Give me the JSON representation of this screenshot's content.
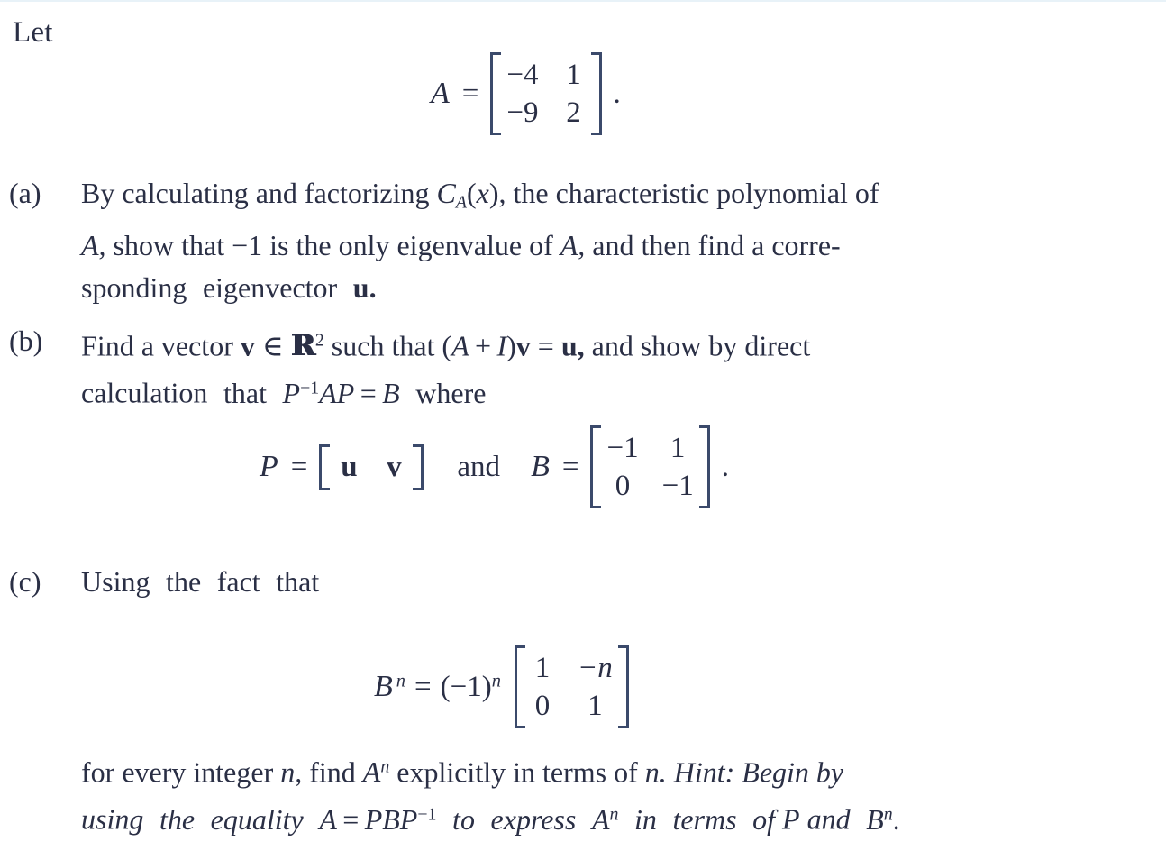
{
  "document": {
    "type": "math-exercise",
    "lead_text": "Let",
    "text_color": "#2a2f45",
    "bracket_color": "#3b4a6b"
  },
  "matrix_A": {
    "label": "A",
    "equals": "=",
    "rows": [
      [
        "−4",
        "1"
      ],
      [
        "−9",
        "2"
      ]
    ],
    "trailing_punctuation": "."
  },
  "parts": [
    {
      "marker": "(a)",
      "lines": [
        {
          "segments": [
            "By",
            "calculating",
            "and",
            "factorizing",
            "C",
            "A",
            "(",
            "x",
            "),",
            "the",
            "characteristic",
            "polynomial",
            "of"
          ],
          "plain": "By calculating and factorizing C_A(x), the characteristic polynomial of"
        },
        {
          "plain": "A, show that −1 is the only eigenvalue of A, and then find a corre-"
        },
        {
          "plain": "sponding eigenvector u."
        }
      ],
      "tokens": {
        "w_by": "By",
        "w_calculating": "calculating",
        "w_and": "and",
        "w_factorizing": "factorizing",
        "c_sym": "C",
        "c_sub": "A",
        "paren_open": "(",
        "var_x": "x",
        "paren_close_comma": "),",
        "w_the": "the",
        "w_characteristic": "characteristic",
        "w_polynomial": "polynomial",
        "w_of": "of",
        "var_A1": "A,",
        "w_show": "show",
        "w_that": "that",
        "val_neg1": "−1",
        "w_is": "is",
        "w_the2": "the",
        "w_only": "only",
        "w_eigenvalue": "eigenvalue",
        "w_of2": "of",
        "var_A2": "A,",
        "w_and2": "and",
        "w_then": "then",
        "w_find": "find",
        "w_a": "a",
        "w_corre": "corre-",
        "w_sponding": "sponding",
        "w_eigenvector": "eigenvector",
        "vec_u": "u."
      }
    },
    {
      "marker": "(b)",
      "tokens": {
        "w_find": "Find",
        "w_a": "a",
        "w_vector": "vector",
        "vec_v": "v",
        "sym_in": "∈",
        "set_R": "R",
        "set_R_sup": "2",
        "w_such": "such",
        "w_that": "that",
        "grp_open": "(",
        "var_A": "A",
        "plus": "+",
        "var_I": "I",
        "grp_close": ")",
        "vec_v2": "v",
        "equals": "=",
        "vec_u": "u,",
        "w_and": "and",
        "w_show": "show",
        "w_by": "by",
        "w_direct": "direct",
        "w_calculation": "calculation",
        "w_that2": "that",
        "var_P": "P",
        "sup_inv": "−1",
        "var_AP": "AP",
        "equals2": "=",
        "var_B": "B",
        "w_where": "where"
      },
      "lines": [
        {
          "plain": "Find a vector v ∈ R^2 such that (A + I)v = u, and show by direct"
        },
        {
          "plain": "calculation that P^{-1}AP = B where"
        }
      ]
    },
    {
      "marker": "(c)",
      "tokens": {
        "w_using": "Using",
        "w_the": "the",
        "w_fact": "fact",
        "w_that": "that"
      },
      "lines": [
        {
          "plain": "Using the fact that"
        }
      ]
    }
  ],
  "equation_PB": {
    "P_label": "P",
    "P_equals": "=",
    "P_entries": [
      "u",
      "v"
    ],
    "conjunction": "and",
    "B_label": "B",
    "B_equals": "=",
    "B_rows": [
      [
        "−1",
        "1"
      ],
      [
        "0",
        "−1"
      ]
    ],
    "trailing_punctuation": "."
  },
  "equation_Bn": {
    "lhs_base": "B",
    "lhs_exponent": "n",
    "equals": "=",
    "scalar": "(−1)",
    "scalar_exponent": "n",
    "rows": [
      [
        "1",
        "−n"
      ],
      [
        "0",
        "1"
      ]
    ]
  },
  "closing": {
    "line1_tokens": {
      "w_for": "for",
      "w_every": "every",
      "w_integer": "integer",
      "var_n": "n,",
      "w_find": "find",
      "var_A": "A",
      "var_A_sup": "n",
      "w_explicitly": "explicitly",
      "w_in": "in",
      "w_terms": "terms",
      "w_of": "of",
      "var_n2": "n.",
      "hint_label": "Hint:",
      "hint_w1": "Begin",
      "hint_w2": "by"
    },
    "line2_tokens": {
      "w_using": "using",
      "w_the": "the",
      "w_equality": "equality",
      "var_A": "A",
      "equals": "=",
      "var_PBP": "PBP",
      "sup_inv": "−1",
      "w_to": "to",
      "w_express": "express",
      "var_An": "A",
      "var_An_sup": "n",
      "w_in": "in",
      "w_terms": "terms",
      "w_of": "of",
      "var_P": "P",
      "w_and": "and",
      "var_B": "B",
      "var_B_sup": "n",
      "period": "."
    },
    "line1_plain": "for every integer n, find A^n explicitly in terms of n. Hint: Begin by",
    "line2_plain": "using the equality A = PBP^{-1} to express A^n in terms of P and B^n."
  }
}
